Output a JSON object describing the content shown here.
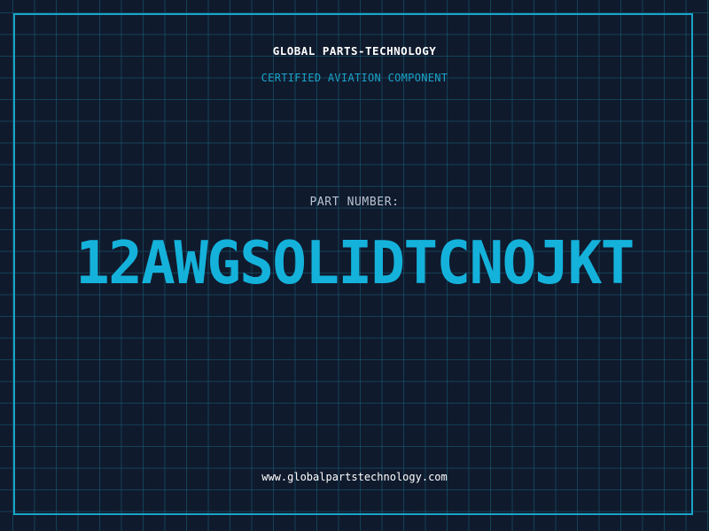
{
  "header": {
    "company": "GLOBAL PARTS-TECHNOLOGY",
    "subtitle": "CERTIFIED AVIATION COMPONENT"
  },
  "part": {
    "label": "PART NUMBER:",
    "number": "12AWGSOLIDTCNOJKT"
  },
  "footer": {
    "website": "www.globalpartstechnology.com"
  },
  "colors": {
    "background": "#101a2d",
    "accent": "#1aa3c8",
    "part_number": "#14b2db",
    "text": "#ffffff",
    "muted": "#b9c4d2"
  }
}
